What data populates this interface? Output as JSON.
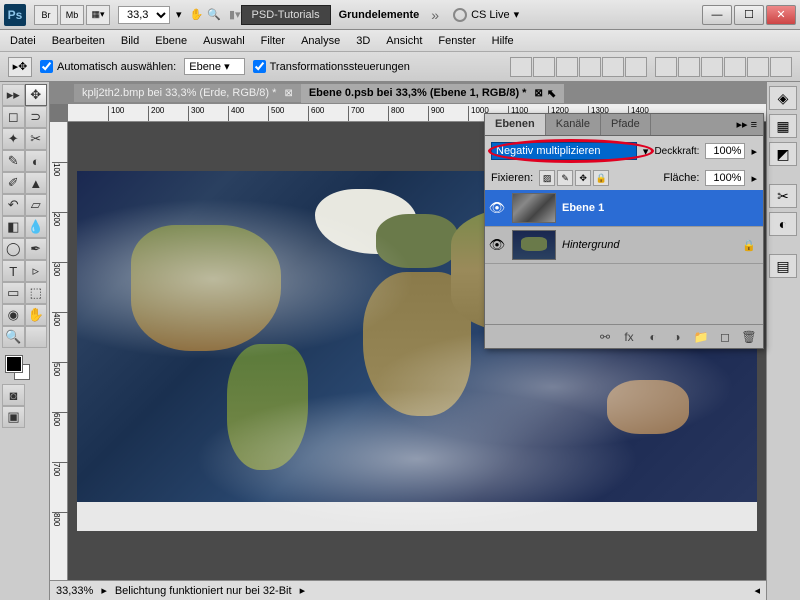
{
  "titlebar": {
    "app_icon": "Ps",
    "doc_buttons": [
      "Br",
      "Mb",
      "▦▾"
    ],
    "zoom": "33,3",
    "psd_tutorials": "PSD-Tutorials",
    "breadcrumb": "Grundelemente",
    "cslive": "CS Live"
  },
  "menu": [
    "Datei",
    "Bearbeiten",
    "Bild",
    "Ebene",
    "Auswahl",
    "Filter",
    "Analyse",
    "3D",
    "Ansicht",
    "Fenster",
    "Hilfe"
  ],
  "options": {
    "auto_select": "Automatisch auswählen:",
    "auto_select_value": "Ebene",
    "transform": "Transformationssteuerungen"
  },
  "doc_tabs": [
    {
      "label": "kplj2th2.bmp bei 33,3% (Erde, RGB/8) *",
      "active": false
    },
    {
      "label": "Ebene 0.psb bei 33,3% (Ebene 1, RGB/8) *",
      "active": true
    }
  ],
  "ruler_h": [
    "100",
    "200",
    "300",
    "400",
    "500",
    "600",
    "700",
    "800",
    "900",
    "1000",
    "1100",
    "1200",
    "1300",
    "1400"
  ],
  "ruler_v": [
    "100",
    "200",
    "300",
    "400",
    "500",
    "600",
    "700",
    "800"
  ],
  "layers_panel": {
    "tabs": [
      "Ebenen",
      "Kanäle",
      "Pfade"
    ],
    "blend_mode": "Negativ multiplizieren",
    "opacity_label": "Deckkraft:",
    "opacity": "100%",
    "lock_label": "Fixieren:",
    "fill_label": "Fläche:",
    "fill": "100%",
    "layers": [
      {
        "name": "Ebene 1",
        "selected": true,
        "locked": false,
        "thumb": "grey"
      },
      {
        "name": "Hintergrund",
        "selected": false,
        "locked": true,
        "thumb": "color"
      }
    ]
  },
  "status": {
    "zoom": "33,33%",
    "msg": "Belichtung funktioniert nur bei 32-Bit"
  }
}
